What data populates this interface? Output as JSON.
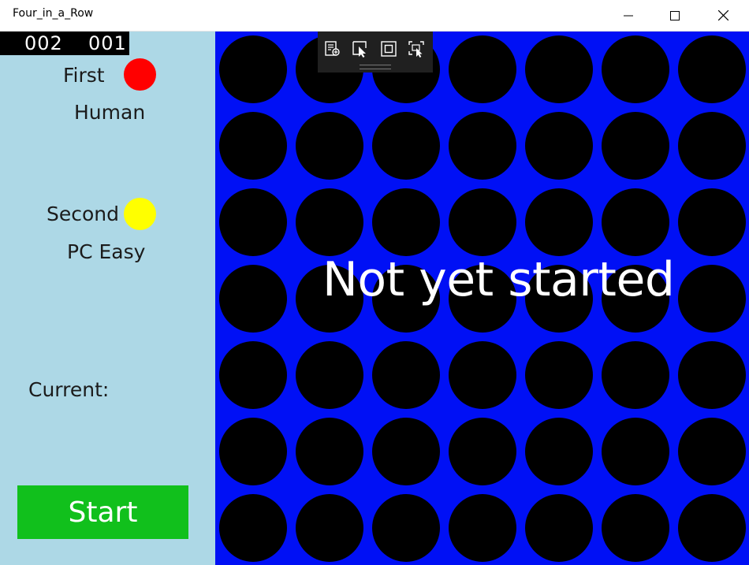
{
  "window": {
    "title": "Four_in_a_Row"
  },
  "scores": {
    "first": "002",
    "second": "001"
  },
  "players": {
    "first": {
      "label": "First",
      "type": "Human",
      "color": "#ff0000"
    },
    "second": {
      "label": "Second",
      "type": "PC Easy",
      "color": "#ffff00"
    }
  },
  "current": {
    "label": "Current:"
  },
  "start_button": {
    "label": "Start"
  },
  "board": {
    "columns": 7,
    "rows": 7,
    "background": "#0010f5",
    "cell_color": "#000000",
    "status": "Not yet started"
  },
  "debug_toolbar": {
    "tools": [
      "live-visual-tree-icon",
      "select-element-icon",
      "display-layout-adorners-icon",
      "track-focus-icon"
    ]
  },
  "colors": {
    "side_panel": "#add8e6",
    "start_button": "#11c01c"
  }
}
